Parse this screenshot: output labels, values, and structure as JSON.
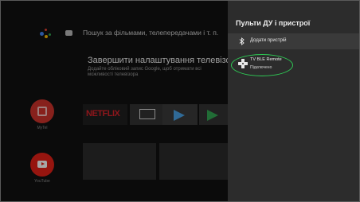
{
  "search": {
    "placeholder_text": "Пошук за фільмами, телепередачами і т. п."
  },
  "setup_card": {
    "title": "Завершити налаштування телевізора",
    "subtitle": "Додайте обліковий запис Google, щоб отримати всі можливості телевізора"
  },
  "apps": {
    "netflix_label": "NETFLIX",
    "circle_apps": [
      {
        "label": "MyTel",
        "color": "#d0342c"
      },
      {
        "label": "YouTube",
        "color": "#e62117"
      }
    ]
  },
  "panel": {
    "title": "Пульти ДУ і пристрої",
    "add_device_label": "Додати пристрій",
    "device": {
      "name": "TV BLE Remote",
      "status": "Підключено"
    }
  },
  "colors": {
    "highlight": "#2ecc55",
    "panel_bg": "#2c2c2c"
  }
}
